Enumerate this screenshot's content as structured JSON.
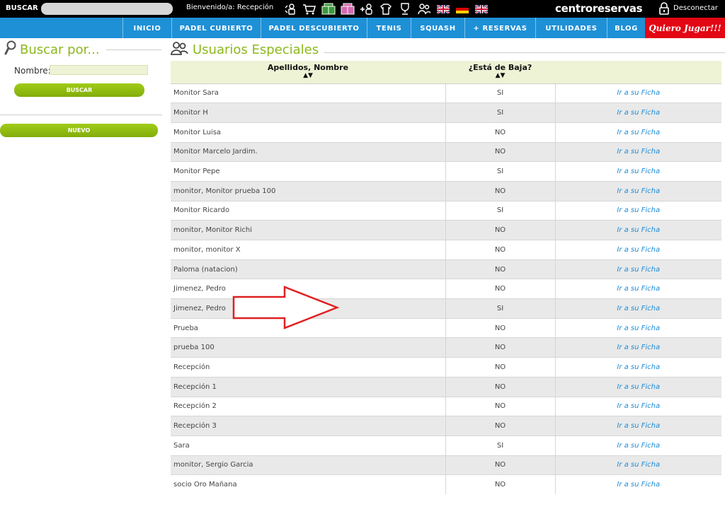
{
  "topbar": {
    "search_label": "BUSCAR",
    "welcome": "Bienvenido/a: Recepción",
    "icons": [
      "user-lock-icon",
      "cart-icon",
      "court-green-icon",
      "court-pink-icon",
      "plus-user-icon",
      "shirt-bag-icon",
      "trophy-icon",
      "users-icon",
      "flag-uk-icon",
      "flag-de-icon",
      "flag-uk-icon"
    ],
    "brand": "centroreservas",
    "logout": "Desconectar"
  },
  "nav": {
    "items": [
      "INICIO",
      "PADEL CUBIERTO",
      "PADEL DESCUBIERTO",
      "TENIS",
      "SQUASH",
      "+ RESERVAS",
      "UTILIDADES",
      "BLOG"
    ],
    "promo": "Quiero Jugar!!!"
  },
  "search_panel": {
    "title": "Buscar por...",
    "name_label": "Nombre:",
    "name_value": "",
    "search_button": "BUSCAR",
    "new_button": "NUEVO"
  },
  "main": {
    "title": "Usuarios Especiales",
    "columns": [
      "Apellidos, Nombre",
      "¿Está de Baja?",
      ""
    ],
    "sort_arrows": "▲▼",
    "rows": [
      {
        "name": "Monitor  Sara",
        "baja": "SI",
        "link": "Ir a su Ficha"
      },
      {
        "name": "Monitor H",
        "baja": "SI",
        "link": "Ir a su Ficha"
      },
      {
        "name": "Monitor Luisa",
        "baja": "NO",
        "link": "Ir a su Ficha"
      },
      {
        "name": "Monitor Marcelo Jardim.",
        "baja": "NO",
        "link": "Ir a su Ficha"
      },
      {
        "name": "Monitor Pepe",
        "baja": "SI",
        "link": "Ir a su Ficha"
      },
      {
        "name": "monitor, Monitor prueba 100",
        "baja": "NO",
        "link": "Ir a su Ficha"
      },
      {
        "name": "Monitor Ricardo",
        "baja": "SI",
        "link": "Ir a su Ficha"
      },
      {
        "name": "monitor, Monitor Richi",
        "baja": "NO",
        "link": "Ir a su Ficha"
      },
      {
        "name": "monitor, monitor X",
        "baja": "NO",
        "link": "Ir a su Ficha"
      },
      {
        "name": "Paloma (natacion)",
        "baja": "NO",
        "link": "Ir a su Ficha"
      },
      {
        "name": "Jimenez, Pedro",
        "baja": "NO",
        "link": "Ir a su Ficha"
      },
      {
        "name": "Jimenez, Pedro",
        "baja": "SI",
        "link": "Ir a su Ficha"
      },
      {
        "name": "Prueba",
        "baja": "NO",
        "link": "Ir a su Ficha"
      },
      {
        "name": "prueba 100",
        "baja": "NO",
        "link": "Ir a su Ficha"
      },
      {
        "name": "Recepción",
        "baja": "NO",
        "link": "Ir a su Ficha"
      },
      {
        "name": "Recepción 1",
        "baja": "NO",
        "link": "Ir a su Ficha"
      },
      {
        "name": "Recepción 2",
        "baja": "NO",
        "link": "Ir a su Ficha"
      },
      {
        "name": "Recepción 3",
        "baja": "NO",
        "link": "Ir a su Ficha"
      },
      {
        "name": "Sara",
        "baja": "SI",
        "link": "Ir a su Ficha"
      },
      {
        "name": "monitor, Sergio Garcia",
        "baja": "NO",
        "link": "Ir a su Ficha"
      },
      {
        "name": "socio Oro Mañana",
        "baja": "NO",
        "link": "Ir a su Ficha"
      }
    ]
  },
  "colors": {
    "nav_blue": "#1e90d6",
    "accent_green": "#8cb81d",
    "promo_red": "#e30613",
    "link_blue": "#1e8bd6",
    "annotation_arrow": "#e02020"
  }
}
